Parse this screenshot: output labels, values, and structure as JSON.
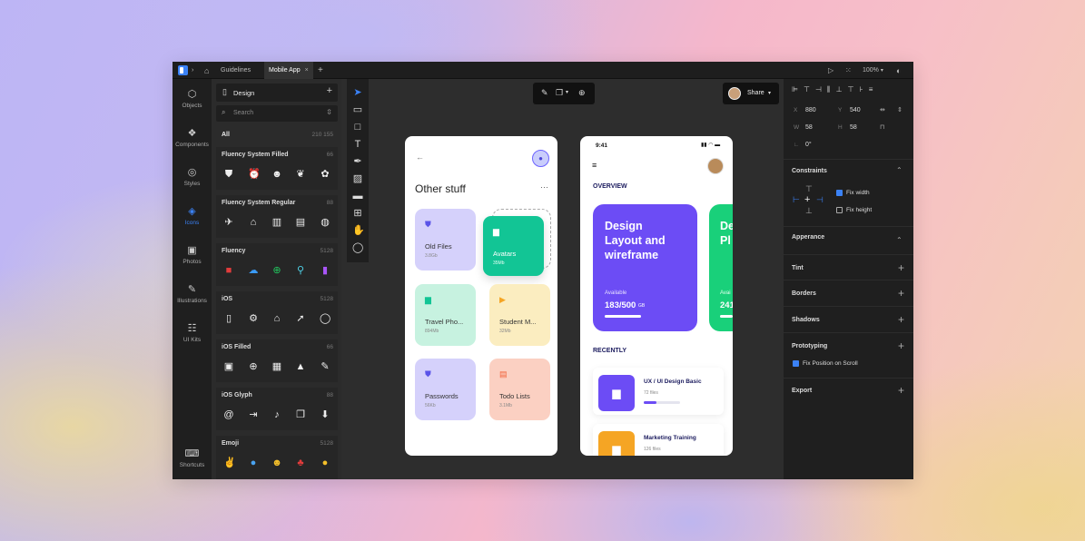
{
  "topbar": {
    "tabs": [
      "Guidelines",
      "Mobile App"
    ],
    "zoom": "100%"
  },
  "sidebar": {
    "items": [
      "Objects",
      "Components",
      "Styles",
      "Icons",
      "Photos",
      "Illustrations",
      "UI Kits",
      "Shortcuts"
    ]
  },
  "left_panel": {
    "title": "Design",
    "search_placeholder": "Search",
    "all_label": "All",
    "all_count": "210 155",
    "sections": [
      {
        "name": "Fluency System Filled",
        "count": "66"
      },
      {
        "name": "Fluency System Regular",
        "count": "88"
      },
      {
        "name": "Fluency",
        "count": "5128"
      },
      {
        "name": "iOS",
        "count": "5128"
      },
      {
        "name": "iOS Filled",
        "count": "66"
      },
      {
        "name": "iOS Glyph",
        "count": "88"
      },
      {
        "name": "Emoji",
        "count": "5128"
      }
    ]
  },
  "canvas_toolbar": {
    "share": "Share"
  },
  "phone1": {
    "title": "Other stuff",
    "more": "···",
    "cards": [
      {
        "name": "Old Files",
        "size": "3.8Gb"
      },
      {
        "name": "Avatars",
        "size": "35Mb"
      },
      {
        "name": "Travel Pho...",
        "size": "894Mb"
      },
      {
        "name": "Student M...",
        "size": "32Mb"
      },
      {
        "name": "Passwords",
        "size": "56Kb"
      },
      {
        "name": "Todo Lists",
        "size": "3.1Mb"
      }
    ]
  },
  "phone2": {
    "time": "9:41",
    "overview": "OVERVIEW",
    "card_title": "Design Layout and wireframe",
    "available": "Available",
    "amount": "183/500",
    "unit": "GB",
    "card2_title": "De Pl",
    "card2_available": "Avai",
    "card2_amount": "241",
    "recently": "RECENTLY",
    "courses": [
      {
        "name": "UX / UI Design Basic",
        "files": "72 files",
        "progress": 0.35
      },
      {
        "name": "Marketing Training",
        "files": "126 files"
      }
    ]
  },
  "right_panel": {
    "x": "880",
    "y": "540",
    "w": "58",
    "h": "58",
    "rotation": "0°",
    "labels": {
      "x": "X",
      "y": "Y",
      "w": "W",
      "h": "H"
    },
    "constraints": "Constraints",
    "fix_width": "Fix width",
    "fix_height": "Fix height",
    "appearance": "Apperance",
    "rows": [
      "Tint",
      "Borders",
      "Shadows"
    ],
    "prototyping": "Prototyping",
    "fix_scroll": "Fix Position on Scroll",
    "export": "Export"
  },
  "colors": {
    "accent": "#3b82f6",
    "purple": "#6c4cf5",
    "green": "#19d07a",
    "teal": "#12c595"
  }
}
